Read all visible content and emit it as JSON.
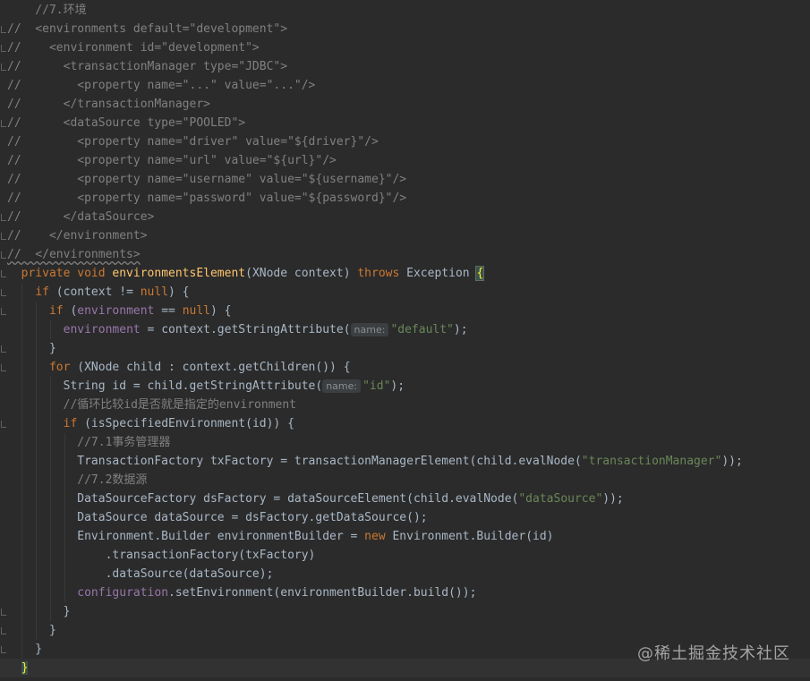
{
  "lines": [
    {
      "parts": [
        {
          "t": "    //7.环境",
          "c": "comment"
        }
      ]
    },
    {
      "parts": [
        {
          "t": "//  <environments default=\"development\">",
          "c": "comment"
        }
      ]
    },
    {
      "parts": [
        {
          "t": "//    <environment id=\"development\">",
          "c": "comment"
        }
      ]
    },
    {
      "parts": [
        {
          "t": "//      <transactionManager type=\"JDBC\">",
          "c": "comment"
        }
      ]
    },
    {
      "parts": [
        {
          "t": "//        <property name=\"...\" value=\"...\"/>",
          "c": "comment"
        }
      ]
    },
    {
      "parts": [
        {
          "t": "//      </transactionManager>",
          "c": "comment"
        }
      ]
    },
    {
      "parts": [
        {
          "t": "//      <dataSource type=\"POOLED\">",
          "c": "comment"
        }
      ]
    },
    {
      "parts": [
        {
          "t": "//        <property name=\"driver\" value=\"${driver}\"/>",
          "c": "comment"
        }
      ]
    },
    {
      "parts": [
        {
          "t": "//        <property name=\"url\" value=\"${url}\"/>",
          "c": "comment"
        }
      ]
    },
    {
      "parts": [
        {
          "t": "//        <property name=\"username\" value=\"${username}\"/>",
          "c": "comment"
        }
      ]
    },
    {
      "parts": [
        {
          "t": "//        <property name=\"password\" value=\"${password}\"/>",
          "c": "comment"
        }
      ]
    },
    {
      "parts": [
        {
          "t": "//      </dataSource>",
          "c": "comment"
        }
      ]
    },
    {
      "parts": [
        {
          "t": "//    </environment>",
          "c": "comment"
        }
      ]
    },
    {
      "parts": [
        {
          "t": "//  </environments>",
          "c": "comment-squiggle"
        }
      ]
    },
    {
      "parts": [
        {
          "t": "  ",
          "c": "plain"
        },
        {
          "t": "private void ",
          "c": "keyword"
        },
        {
          "t": "environmentsElement",
          "c": "method"
        },
        {
          "t": "(XNode context) ",
          "c": "plain"
        },
        {
          "t": "throws ",
          "c": "keyword"
        },
        {
          "t": "Exception ",
          "c": "plain"
        },
        {
          "t": "{",
          "c": "brace"
        }
      ]
    },
    {
      "parts": [
        {
          "t": "    ",
          "c": "plain"
        },
        {
          "t": "if ",
          "c": "keyword"
        },
        {
          "t": "(context != ",
          "c": "plain"
        },
        {
          "t": "null",
          "c": "keyword"
        },
        {
          "t": ") {",
          "c": "plain"
        }
      ]
    },
    {
      "parts": [
        {
          "t": "      ",
          "c": "plain"
        },
        {
          "t": "if ",
          "c": "keyword"
        },
        {
          "t": "(",
          "c": "plain"
        },
        {
          "t": "environment",
          "c": "field"
        },
        {
          "t": " == ",
          "c": "plain"
        },
        {
          "t": "null",
          "c": "keyword"
        },
        {
          "t": ") {",
          "c": "plain"
        }
      ]
    },
    {
      "parts": [
        {
          "t": "        ",
          "c": "plain"
        },
        {
          "t": "environment",
          "c": "field"
        },
        {
          "t": " = context.getStringAttribute(",
          "c": "plain"
        },
        {
          "t": "name:",
          "c": "hint"
        },
        {
          "t": "\"default\"",
          "c": "string"
        },
        {
          "t": ");",
          "c": "plain"
        }
      ]
    },
    {
      "parts": [
        {
          "t": "      }",
          "c": "plain"
        }
      ]
    },
    {
      "parts": [
        {
          "t": "      ",
          "c": "plain"
        },
        {
          "t": "for ",
          "c": "keyword"
        },
        {
          "t": "(XNode child : context.getChildren()) {",
          "c": "plain"
        }
      ]
    },
    {
      "parts": [
        {
          "t": "        String id = child.getStringAttribute(",
          "c": "plain"
        },
        {
          "t": "name:",
          "c": "hint"
        },
        {
          "t": "\"id\"",
          "c": "string"
        },
        {
          "t": ");",
          "c": "plain"
        }
      ]
    },
    {
      "parts": [
        {
          "t": "        //循环比较id是否就是指定的environment",
          "c": "comment"
        }
      ]
    },
    {
      "parts": [
        {
          "t": "        ",
          "c": "plain"
        },
        {
          "t": "if ",
          "c": "keyword"
        },
        {
          "t": "(isSpecifiedEnvironment(id)) {",
          "c": "plain"
        }
      ]
    },
    {
      "parts": [
        {
          "t": "          //7.1事务管理器",
          "c": "comment"
        }
      ]
    },
    {
      "parts": [
        {
          "t": "          TransactionFactory txFactory = transactionManagerElement(child.evalNode(",
          "c": "plain"
        },
        {
          "t": "\"transactionManager\"",
          "c": "string"
        },
        {
          "t": "));",
          "c": "plain"
        }
      ]
    },
    {
      "parts": [
        {
          "t": "          //7.2数据源",
          "c": "comment"
        }
      ]
    },
    {
      "parts": [
        {
          "t": "          DataSourceFactory dsFactory = dataSourceElement(child.evalNode(",
          "c": "plain"
        },
        {
          "t": "\"dataSource\"",
          "c": "string"
        },
        {
          "t": "));",
          "c": "plain"
        }
      ]
    },
    {
      "parts": [
        {
          "t": "          DataSource dataSource = dsFactory.getDataSource();",
          "c": "plain"
        }
      ]
    },
    {
      "parts": [
        {
          "t": "          Environment.Builder environmentBuilder = ",
          "c": "plain"
        },
        {
          "t": "new ",
          "c": "keyword"
        },
        {
          "t": "Environment.Builder(id)",
          "c": "plain"
        }
      ]
    },
    {
      "parts": [
        {
          "t": "              .transactionFactory(txFactory)",
          "c": "plain"
        }
      ]
    },
    {
      "parts": [
        {
          "t": "              .dataSource(dataSource);",
          "c": "plain"
        }
      ]
    },
    {
      "parts": [
        {
          "t": "          ",
          "c": "plain"
        },
        {
          "t": "configuration",
          "c": "field"
        },
        {
          "t": ".setEnvironment(environmentBuilder.build());",
          "c": "plain"
        }
      ]
    },
    {
      "parts": [
        {
          "t": "        }",
          "c": "plain"
        }
      ]
    },
    {
      "parts": [
        {
          "t": "      }",
          "c": "plain"
        }
      ]
    },
    {
      "parts": [
        {
          "t": "    }",
          "c": "plain"
        }
      ]
    },
    {
      "parts": [
        {
          "t": "  ",
          "c": "plain"
        },
        {
          "t": "}",
          "c": "brace-end"
        }
      ]
    }
  ],
  "watermark": "@稀土掘金技术社区",
  "colors": {
    "background": "#2b2b2b",
    "comment": "#808080",
    "keyword": "#cc7832",
    "method": "#ffc66d",
    "string": "#6a8759",
    "field": "#9876aa",
    "plain": "#a9b7c6"
  }
}
